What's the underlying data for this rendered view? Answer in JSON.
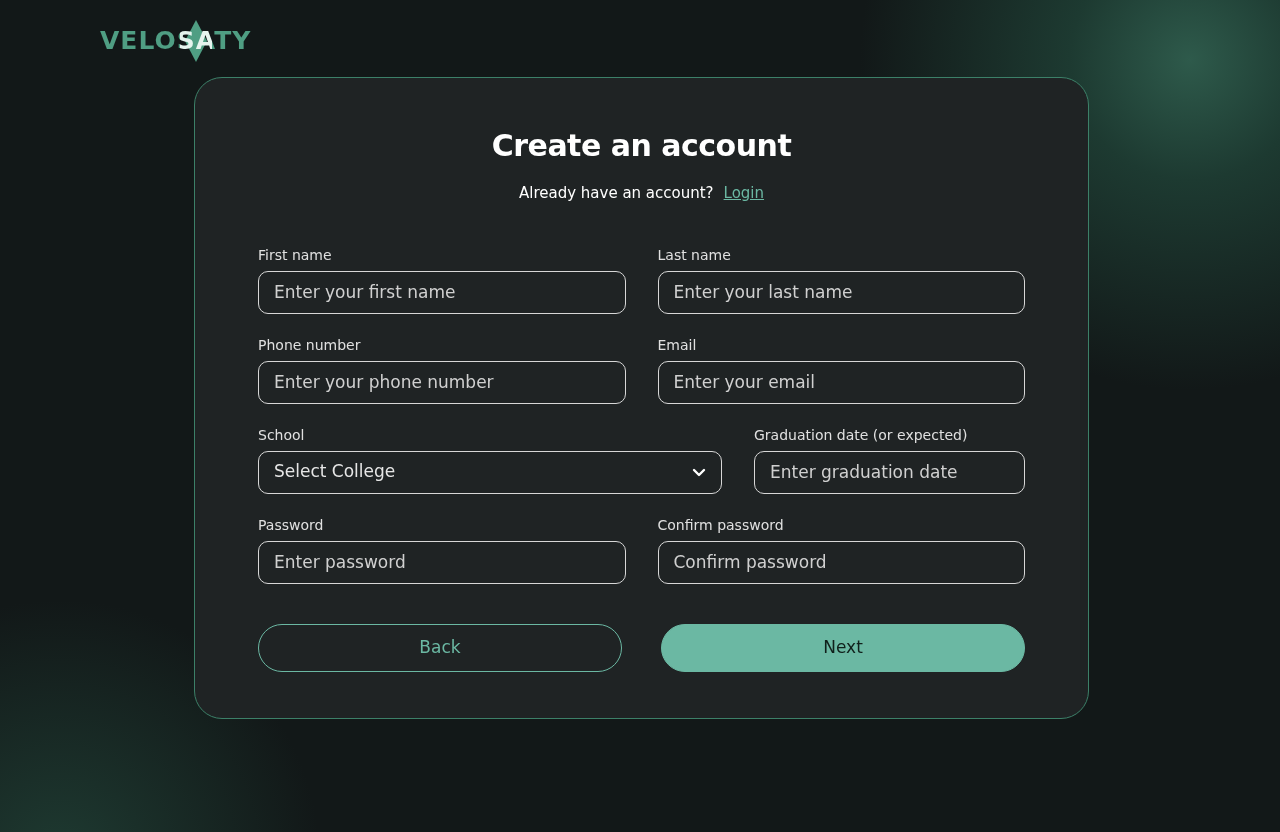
{
  "logo": {
    "text": "VELOSATY"
  },
  "form": {
    "title": "Create an account",
    "prompt": "Already have an account?",
    "login_link": "Login",
    "rows": [
      [
        {
          "label": "First name",
          "kind": "input",
          "placeholder": "Enter your first name"
        },
        {
          "label": "Last name",
          "kind": "input",
          "placeholder": "Enter your last name"
        }
      ],
      [
        {
          "label": "Phone number",
          "kind": "input",
          "placeholder": "Enter your phone number"
        },
        {
          "label": "Email",
          "kind": "input",
          "placeholder": "Enter your email"
        }
      ],
      [
        {
          "label": "School",
          "kind": "select",
          "value": "Select College"
        },
        {
          "label": "Graduation date (or expected)",
          "kind": "input",
          "placeholder": "Enter graduation date"
        }
      ],
      [
        {
          "label": "Password",
          "kind": "input",
          "placeholder": "Enter password"
        },
        {
          "label": "Confirm password",
          "kind": "input",
          "placeholder": "Confirm password"
        }
      ]
    ],
    "buttons": [
      {
        "label": "Back",
        "kind": "outline"
      },
      {
        "label": "Next",
        "kind": "primary"
      }
    ]
  }
}
